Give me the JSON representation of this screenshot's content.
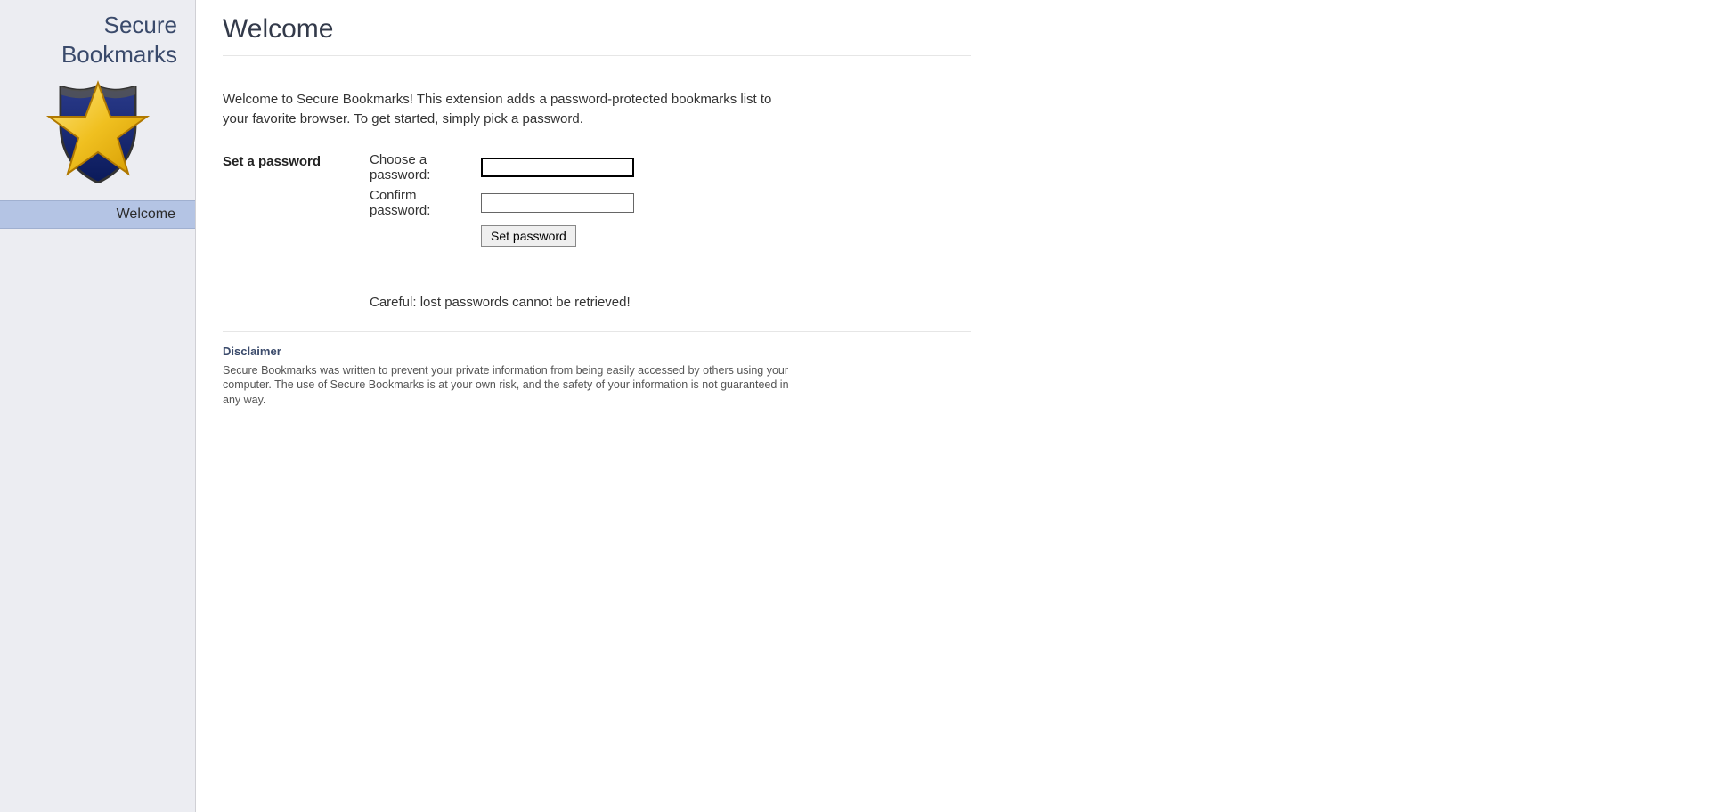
{
  "sidebar": {
    "title": "Secure Bookmarks",
    "nav": {
      "welcome": "Welcome"
    }
  },
  "page": {
    "title": "Welcome",
    "intro": "Welcome to Secure Bookmarks! This extension adds a password-protected bookmarks list to your favorite browser. To get started, simply pick a password."
  },
  "form": {
    "section_label": "Set a password",
    "choose_label": "Choose a password:",
    "confirm_label": "Confirm password:",
    "submit_label": "Set password",
    "warning": "Careful: lost passwords cannot be retrieved!"
  },
  "disclaimer": {
    "heading": "Disclaimer",
    "text": "Secure Bookmarks was written to prevent your private information from being easily accessed by others using your computer. The use of Secure Bookmarks is at your own risk, and the safety of your information is not guaranteed in any way."
  }
}
